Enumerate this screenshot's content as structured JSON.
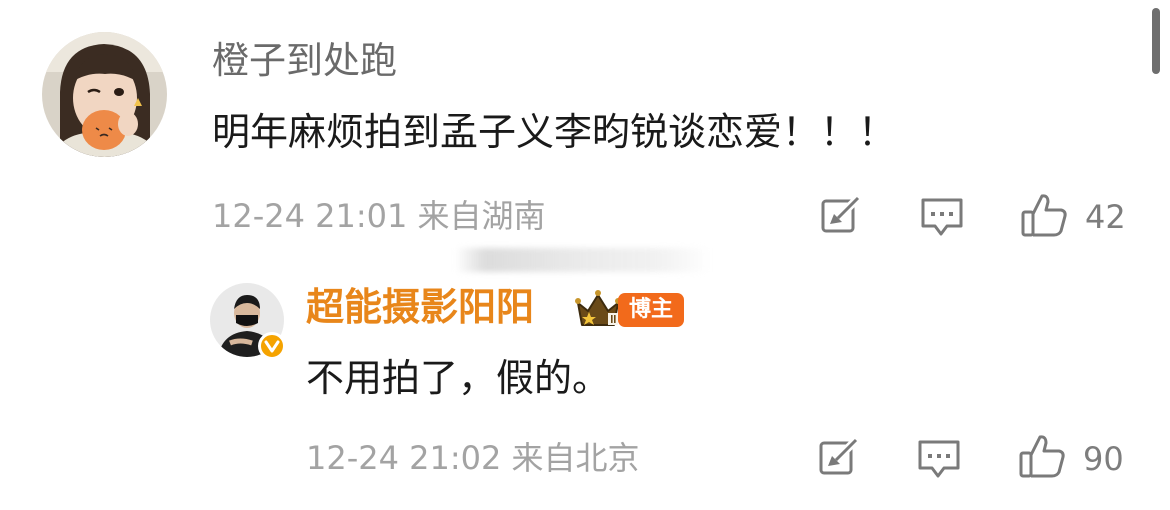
{
  "comment": {
    "username": "橙子到处跑",
    "text": "明年麻烦拍到孟子义李昀锐谈恋爱！！！",
    "meta": "12-24 21:01 来自湖南",
    "like_count": "42"
  },
  "reply": {
    "username": "超能摄影阳阳",
    "badge": "博主",
    "text": "不用拍了，假的。",
    "meta": "12-24 21:02 来自北京",
    "like_count": "90"
  },
  "icons": {
    "share": "share-icon",
    "comment": "comment-icon",
    "like": "thumbs-up-icon",
    "crown": "crown-icon",
    "verified": "verified-v-icon"
  },
  "colors": {
    "reply_username": "#e8861a",
    "role_badge": "#f26a1b",
    "verified_badge": "#f5a300",
    "meta_text": "#a3a3a3",
    "body_text": "#1a1a1a"
  }
}
